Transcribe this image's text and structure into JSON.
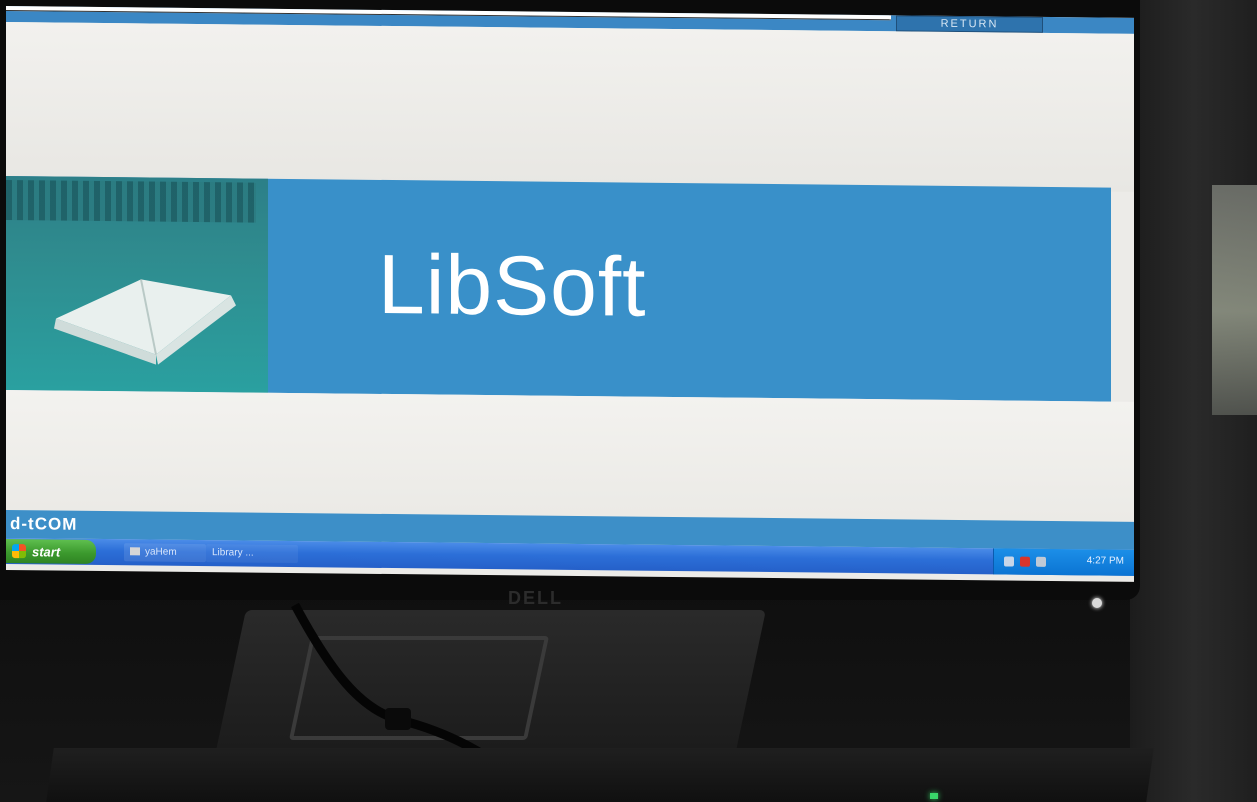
{
  "screen": {
    "top_bar_label": "RETURN",
    "banner_title": "LibSoft",
    "footer_brand": "d-tCOM"
  },
  "taskbar": {
    "start_label": "start",
    "tasks": [
      {
        "label": "yaHem"
      },
      {
        "label": "Library ..."
      }
    ],
    "clock": "4:27 PM"
  },
  "monitor": {
    "brand": "DELL"
  },
  "icons": {
    "start": "windows-logo-icon",
    "task": "window-icon",
    "tray": [
      "network-icon",
      "antivirus-icon",
      "speaker-icon"
    ]
  },
  "colors": {
    "banner_blue": "#3990c9",
    "taskbar_blue": "#2c6fd8",
    "start_green": "#3c9a2e"
  }
}
